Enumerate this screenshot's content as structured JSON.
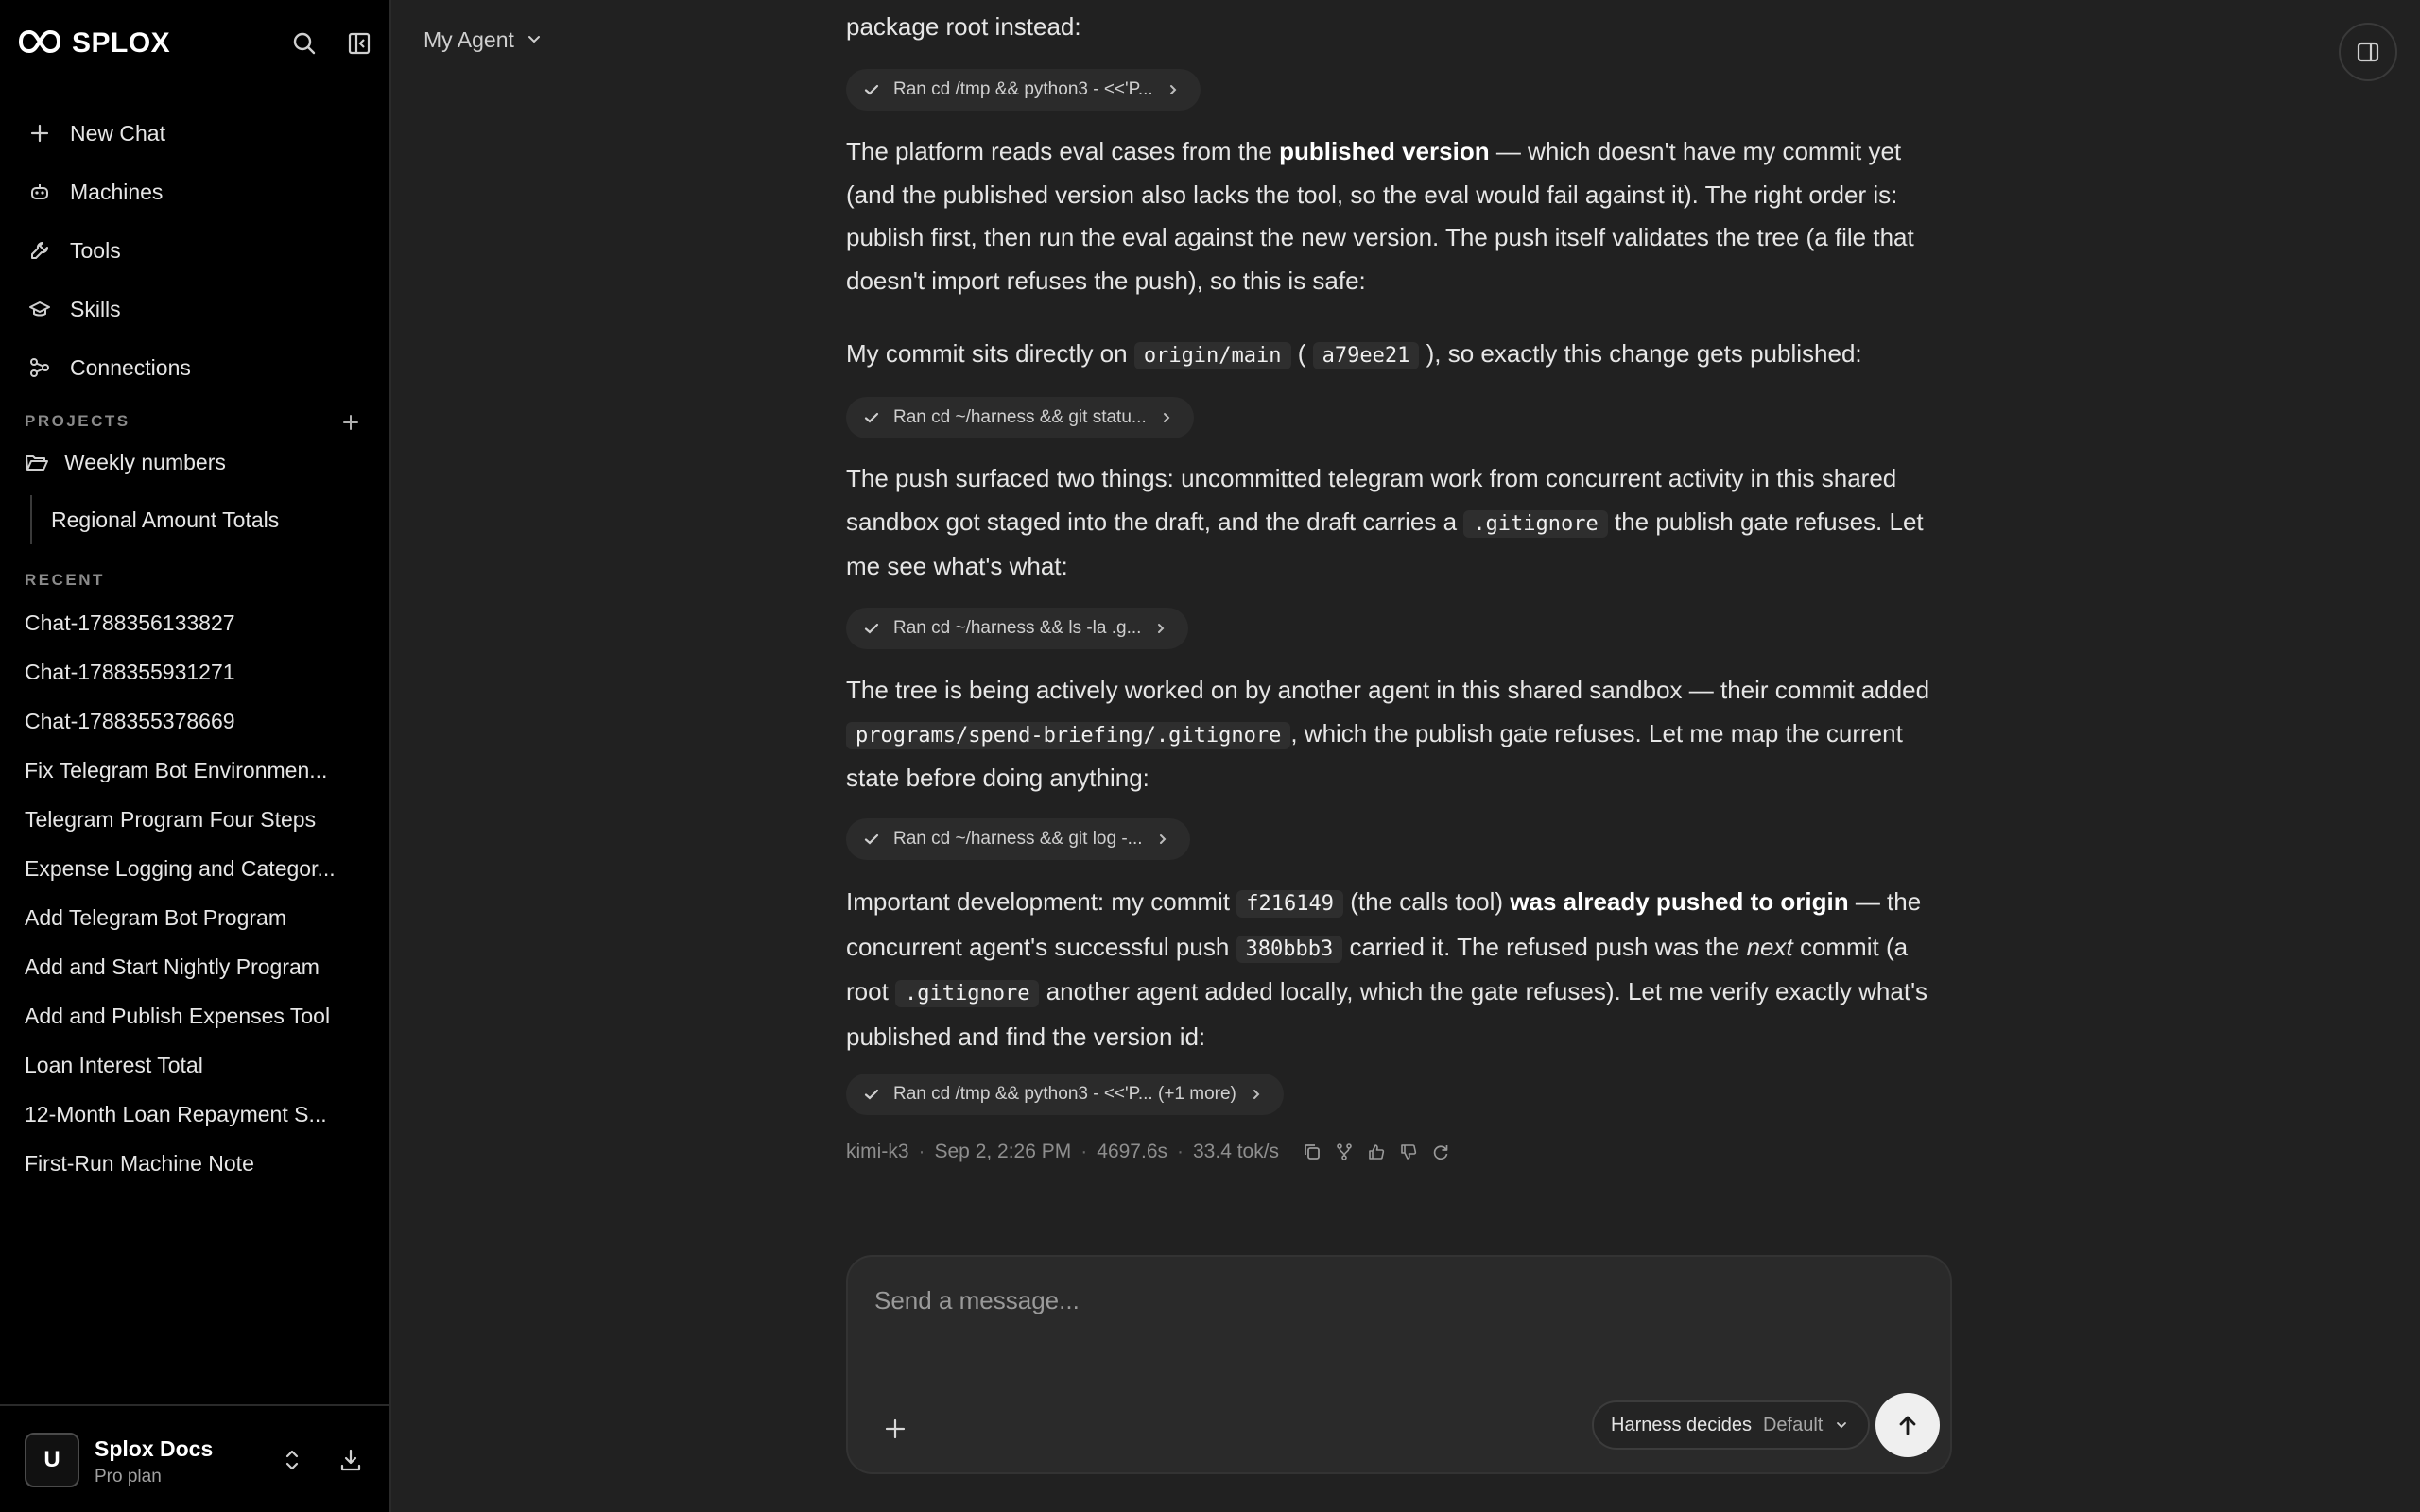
{
  "sidebar": {
    "brand": "SPLOX",
    "nav": [
      {
        "label": "New Chat",
        "icon": "plus-icon"
      },
      {
        "label": "Machines",
        "icon": "robot-icon"
      },
      {
        "label": "Tools",
        "icon": "wrench-icon"
      },
      {
        "label": "Skills",
        "icon": "graduation-cap-icon"
      },
      {
        "label": "Connections",
        "icon": "connections-icon"
      }
    ],
    "projects_heading": "PROJECTS",
    "project": {
      "label": "Weekly numbers",
      "sub": "Regional Amount Totals"
    },
    "recent_heading": "RECENT",
    "recent": [
      "Chat-1788356133827",
      "Chat-1788355931271",
      "Chat-1788355378669",
      "Fix Telegram Bot Environmen...",
      "Telegram Program Four Steps",
      "Expense Logging and Categor...",
      "Add Telegram Bot Program",
      "Add and Start Nightly Program",
      "Add and Publish Expenses Tool",
      "Loan Interest Total",
      "12-Month Loan Repayment S...",
      "First-Run Machine Note"
    ],
    "account": {
      "initial": "U",
      "name": "Splox Docs",
      "plan": "Pro plan"
    }
  },
  "header": {
    "agent": "My Agent"
  },
  "messages": {
    "m0": "package root instead:",
    "chip1": "Ran cd /tmp && python3 - <<'P...",
    "m1": {
      "a": "The platform reads eval cases from the ",
      "b": "published version",
      "c": " — which doesn't have my commit yet (and the published version also lacks the tool, so the eval would fail against it). The right order is: publish first, then run the eval against the new version. The push itself validates the tree (a file that doesn't import refuses the push), so this is safe:"
    },
    "m2": {
      "a": "My commit sits directly on ",
      "code1": "origin/main",
      "b": " ( ",
      "code2": "a79ee21",
      "c": " ), so exactly this change gets published:"
    },
    "chip2": "Ran cd ~/harness && git statu...",
    "m3": {
      "a": "The push surfaced two things: uncommitted telegram work from concurrent activity in this shared sandbox got staged into the draft, and the draft carries a ",
      "code1": ".gitignore",
      "b": " the publish gate refuses. Let me see what's what:"
    },
    "chip3": "Ran cd ~/harness && ls -la .g...",
    "m4": {
      "a": "The tree is being actively worked on by another agent in this shared sandbox — their commit added ",
      "code1": "programs/spend-briefing/.gitignore",
      "b": ", which the publish gate refuses. Let me map the current state before doing anything:"
    },
    "chip4": "Ran cd ~/harness && git log -...",
    "m5": {
      "a": "Important development: my commit ",
      "code1": "f216149",
      "b": " (the calls tool) ",
      "bold1": "was already pushed to origin",
      "c": " — the concurrent agent's successful push ",
      "code2": "380bbb3",
      "d": " carried it. The refused push was the ",
      "ital": "next",
      "e": " commit (a root ",
      "code3": ".gitignore",
      "f": " another agent added locally, which the gate refuses). Let me verify exactly what's published and find the version id:"
    },
    "chip5": "Ran cd /tmp && python3 - <<'P... (+1 more)",
    "meta": {
      "model": "kimi-k3",
      "time": "Sep 2, 2:26 PM",
      "duration": "4697.6s",
      "speed": "33.4 tok/s",
      "sep": "·"
    }
  },
  "composer": {
    "placeholder": "Send a message...",
    "mode": "Harness decides",
    "mode_sub": "Default"
  }
}
